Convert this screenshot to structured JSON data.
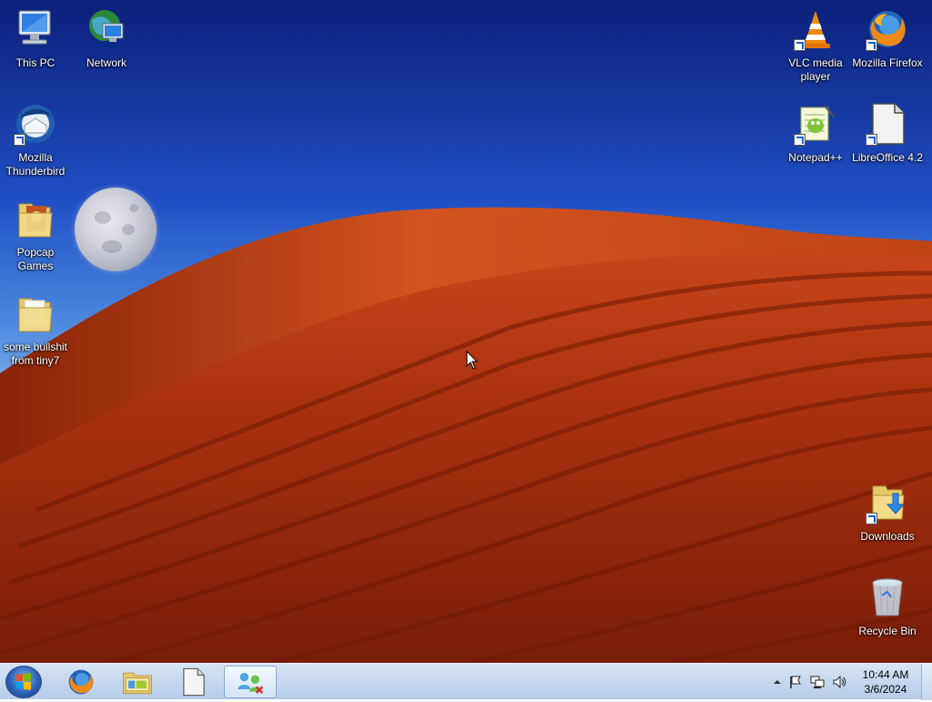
{
  "desktop_icons": {
    "this_pc": "This PC",
    "network": "Network",
    "thunderbird": "Mozilla Thunderbird",
    "popcap": "Popcap Games",
    "tiny7": "some bullshit from tiny7",
    "vlc": "VLC media player",
    "firefox": "Mozilla Firefox",
    "notepadpp": "Notepad++",
    "libreoffice": "LibreOffice 4.2",
    "downloads": "Downloads",
    "recycle_bin": "Recycle Bin"
  },
  "taskbar": {
    "pinned": [
      "firefox-icon",
      "file-explorer-icon",
      "libreoffice-icon",
      "network-app-icon"
    ],
    "active_index": 3
  },
  "tray": {
    "time": "10:44 AM",
    "date": "3/6/2024",
    "icons": [
      "show-hidden-icons-arrow",
      "action-center-flag-icon",
      "network-icon",
      "volume-icon"
    ]
  },
  "colors": {
    "sky_top": "#0c1f7a",
    "sky_bottom": "#b8d2f4",
    "dune": "#b3300e",
    "taskbar": "#c6d9ef"
  }
}
